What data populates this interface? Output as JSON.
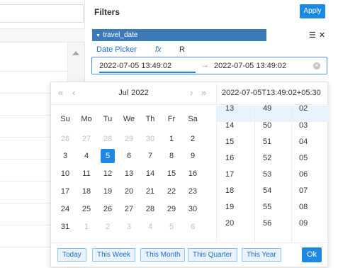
{
  "filters": {
    "title": "Filters",
    "apply_label": "Apply",
    "field": {
      "name": "travel_date",
      "list_icon": "list-icon",
      "close_icon": "close-icon"
    },
    "mode_tabs": [
      "Date Picker",
      "fx",
      "R"
    ],
    "range": {
      "start": "2022-07-05 13:49:02",
      "end": "2022-07-05 13:49:02"
    }
  },
  "picker": {
    "month": "Jul",
    "year": "2022",
    "weekdays": [
      "Su",
      "Mo",
      "Tu",
      "We",
      "Th",
      "Fr",
      "Sa"
    ],
    "weeks": [
      [
        "26",
        "27",
        "28",
        "29",
        "30",
        "1",
        "2"
      ],
      [
        "3",
        "4",
        "5",
        "6",
        "7",
        "8",
        "9"
      ],
      [
        "10",
        "11",
        "12",
        "13",
        "14",
        "15",
        "16"
      ],
      [
        "17",
        "18",
        "19",
        "20",
        "21",
        "22",
        "23"
      ],
      [
        "24",
        "25",
        "26",
        "27",
        "28",
        "29",
        "30"
      ],
      [
        "31",
        "1",
        "2",
        "3",
        "4",
        "5",
        "6"
      ]
    ],
    "selected_day": "5",
    "datetime_display": "2022-07-05T13:49:02+05:30",
    "hours": [
      "13",
      "14",
      "15",
      "16",
      "17",
      "18",
      "19",
      "20"
    ],
    "minutes": [
      "49",
      "50",
      "51",
      "52",
      "53",
      "54",
      "55",
      "56"
    ],
    "seconds": [
      "02",
      "03",
      "04",
      "05",
      "06",
      "07",
      "08",
      "09"
    ],
    "presets": [
      "Today",
      "This Week",
      "This Month",
      "This Quarter",
      "This Year"
    ],
    "ok_label": "Ok"
  },
  "colors": {
    "accent": "#1e88e5",
    "field_bar": "#3d7ab8",
    "highlight": "#e8f3fd"
  }
}
